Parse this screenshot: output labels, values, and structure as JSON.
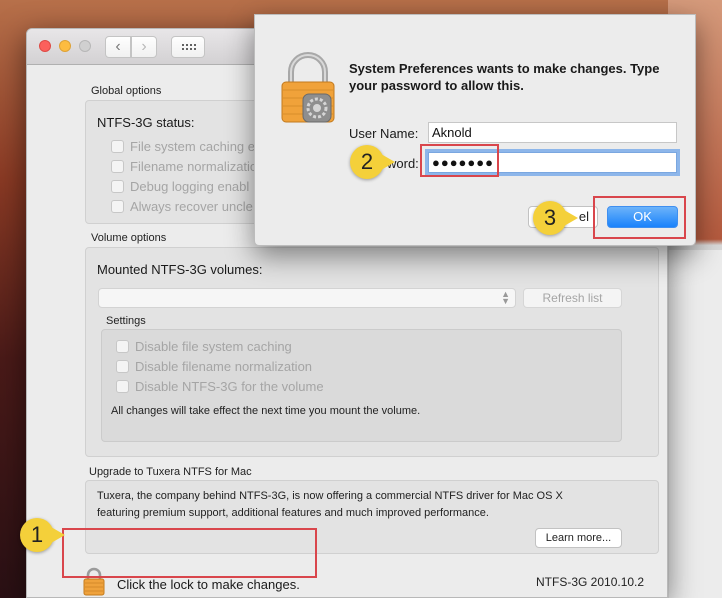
{
  "window": {
    "nav_back_glyph": "‹",
    "nav_forward_glyph": "›"
  },
  "global_options": {
    "section_title": "Global options",
    "status_label": "NTFS-3G status:",
    "checkboxes": [
      "File system caching e",
      "Filename normalizatio",
      "Debug logging enabl",
      "Always recover uncle"
    ]
  },
  "volume_options": {
    "section_title": "Volume options",
    "mounted_label": "Mounted NTFS-3G volumes:",
    "volumes_popup_value": "",
    "refresh_button": "Refresh list",
    "settings": {
      "title": "Settings",
      "checkboxes": [
        "Disable file system caching",
        "Disable filename normalization",
        "Disable NTFS-3G for the volume"
      ],
      "note": "All changes will take effect the next time you mount the volume."
    }
  },
  "upgrade": {
    "section_title": "Upgrade to Tuxera NTFS for Mac",
    "paragraph_line1": "Tuxera, the company behind NTFS-3G, is now offering a commercial NTFS driver for Mac OS X",
    "paragraph_line2": "featuring premium support, additional features and much improved performance.",
    "learn_more_button": "Learn more..."
  },
  "footer": {
    "lock_text": "Click the lock to make changes.",
    "version": "NTFS-3G 2010.10.2"
  },
  "dialog": {
    "message": "System Preferences wants to make changes. Type your password to allow this.",
    "username_label": "User Name:",
    "username_value": "Aknold",
    "password_label_visible": "word:",
    "password_mask": "●●●●●●●",
    "cancel_visible": "el",
    "ok_button": "OK"
  },
  "annotations": {
    "marker1": "1",
    "marker2": "2",
    "marker3": "3"
  },
  "colors": {
    "annotation_red": "#d9464c",
    "marker_yellow": "#f4d03a",
    "ok_blue": "#1a82fb"
  }
}
